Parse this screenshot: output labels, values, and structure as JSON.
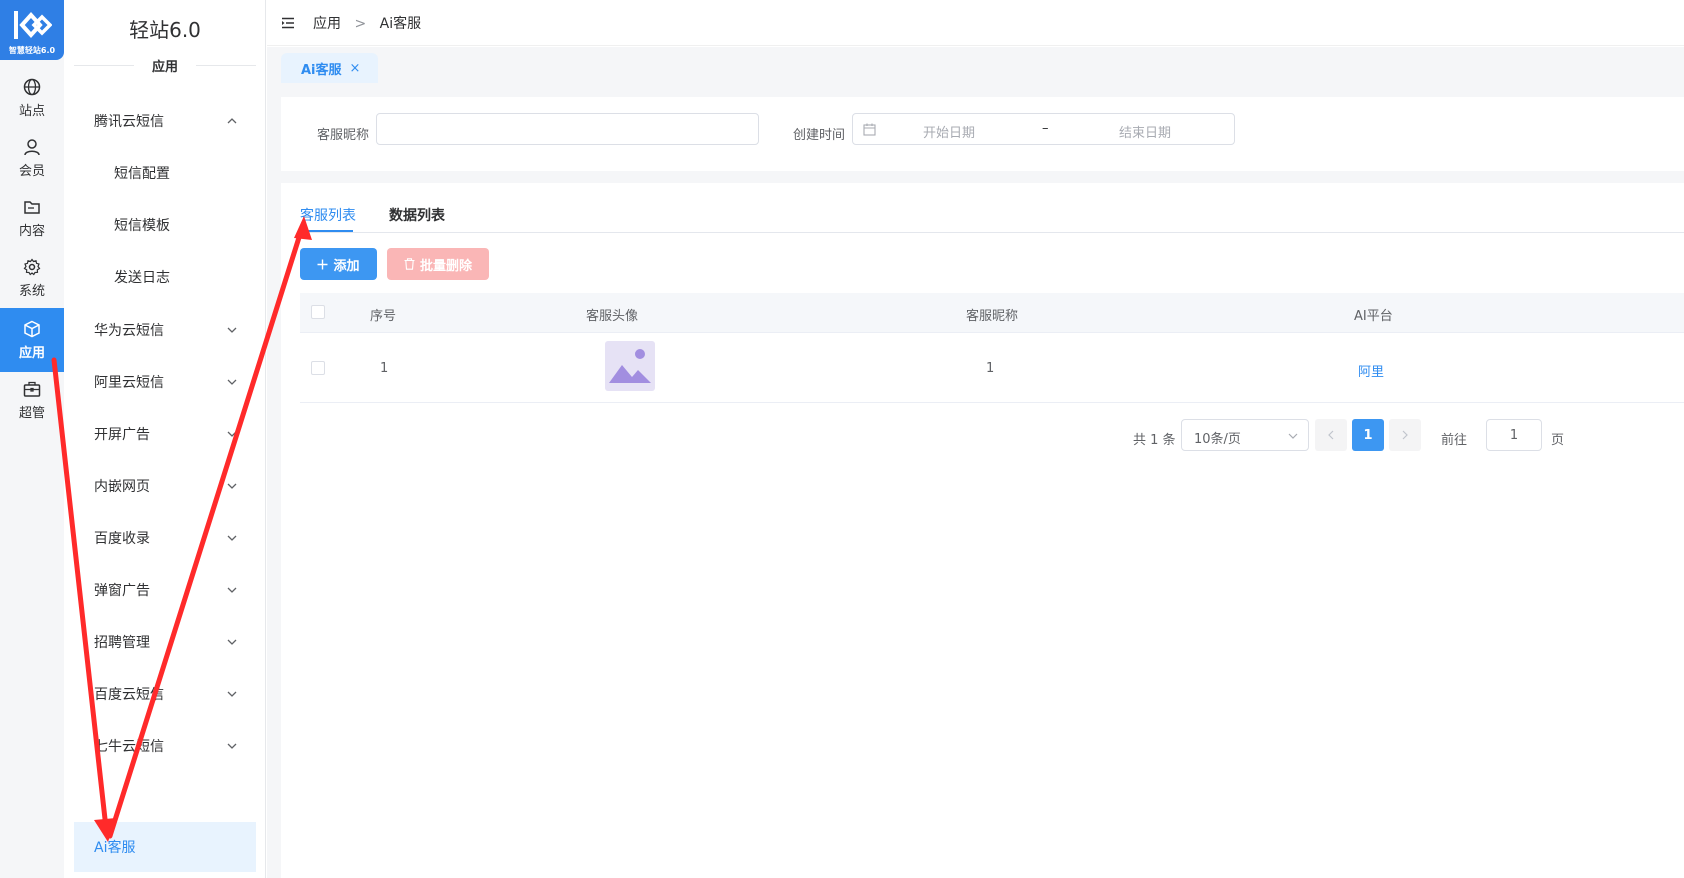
{
  "app": {
    "logo_text": "智慧轻站6.0",
    "brand": "轻站6.0",
    "section": "应用"
  },
  "rail": {
    "items": [
      {
        "label": "站点",
        "icon": "globe-icon"
      },
      {
        "label": "会员",
        "icon": "user-icon"
      },
      {
        "label": "内容",
        "icon": "folder-icon"
      },
      {
        "label": "系统",
        "icon": "gear-icon"
      },
      {
        "label": "应用",
        "icon": "cube-icon",
        "active": true
      },
      {
        "label": "超管",
        "icon": "briefcase-icon"
      }
    ]
  },
  "menu": {
    "items": [
      {
        "label": "腾讯云短信",
        "expanded": true
      },
      {
        "label": "短信配置",
        "sub": true
      },
      {
        "label": "短信模板",
        "sub": true
      },
      {
        "label": "发送日志",
        "sub": true
      },
      {
        "label": "华为云短信"
      },
      {
        "label": "阿里云短信"
      },
      {
        "label": "开屏广告"
      },
      {
        "label": "内嵌网页"
      },
      {
        "label": "百度收录"
      },
      {
        "label": "弹窗广告"
      },
      {
        "label": "招聘管理"
      },
      {
        "label": "百度云短信"
      },
      {
        "label": "七牛云短信"
      },
      {
        "label": "Ai客服",
        "active": true
      }
    ]
  },
  "header": {
    "breadcrumb": [
      "应用",
      "Ai客服"
    ],
    "separator": ">"
  },
  "page_tab": {
    "label": "Ai客服",
    "close": "×"
  },
  "filter": {
    "nickname_label": "客服昵称",
    "nickname_value": "",
    "created_label": "创建时间",
    "start_placeholder": "开始日期",
    "range_sep": "–",
    "end_placeholder": "结束日期"
  },
  "tabs": {
    "list": "客服列表",
    "data": "数据列表"
  },
  "toolbar": {
    "add_label": "添加",
    "batch_delete_label": "批量删除"
  },
  "table": {
    "columns": [
      "序号",
      "客服头像",
      "客服昵称",
      "AI平台"
    ],
    "rows": [
      {
        "index": "1",
        "nickname": "1",
        "platform": "阿里"
      }
    ]
  },
  "pagination": {
    "total": "共 1 条",
    "page_size": "10条/页",
    "current": "1",
    "goto_label": "前往",
    "goto_value": "1",
    "page_suffix": "页"
  },
  "colors": {
    "primary": "#2f8cf0",
    "danger_light": "#fab6b6",
    "annotation": "#ff2a2a"
  }
}
